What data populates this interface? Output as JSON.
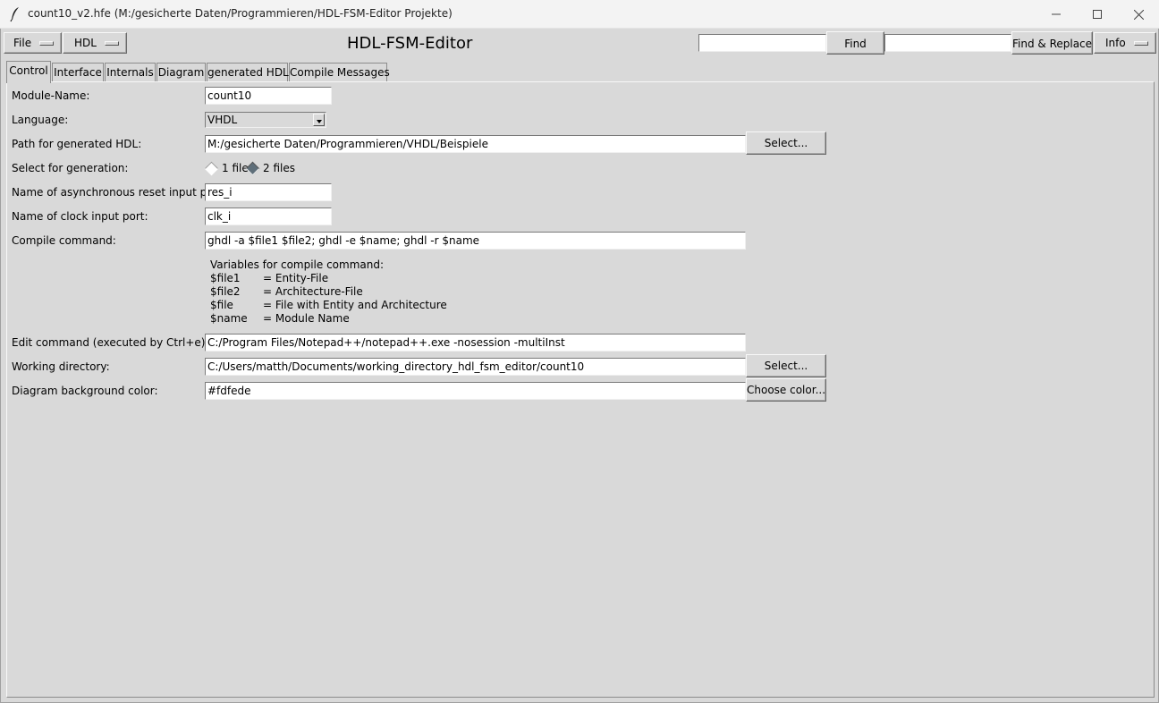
{
  "window": {
    "title": "count10_v2.hfe (M:/gesicherte Daten/Programmieren/HDL-FSM-Editor Projekte)"
  },
  "toolbar": {
    "file_menu": "File",
    "hdl_menu": "HDL",
    "app_title": "HDL-FSM-Editor",
    "find_value": "",
    "find_button": "Find",
    "replace_value": "",
    "find_replace_button": "Find & Replace",
    "info_menu": "Info"
  },
  "tabs": [
    {
      "label": "Control",
      "active": true
    },
    {
      "label": "Interface",
      "active": false
    },
    {
      "label": "Internals",
      "active": false
    },
    {
      "label": "Diagram",
      "active": false
    },
    {
      "label": "generated HDL",
      "active": false
    },
    {
      "label": "Compile Messages",
      "active": false
    }
  ],
  "control": {
    "module_name": {
      "label": "Module-Name:",
      "value": "count10"
    },
    "language": {
      "label": "Language:",
      "value": "VHDL"
    },
    "path": {
      "label": "Path for generated HDL:",
      "value": "M:/gesicherte Daten/Programmieren/VHDL/Beispiele",
      "button": "Select..."
    },
    "generation": {
      "label": "Select for generation:",
      "option1": "1 file",
      "option2": "2 files",
      "selected": "2 files"
    },
    "reset_port": {
      "label": "Name of asynchronous reset input port:",
      "value": "res_i"
    },
    "clock_port": {
      "label": "Name of clock input port:",
      "value": "clk_i"
    },
    "compile": {
      "label": "Compile command:",
      "value": "ghdl -a $file1 $file2; ghdl -e $name; ghdl -r $name"
    },
    "compile_help": {
      "heading": "Variables for compile command:",
      "vars": [
        {
          "name": "$file1",
          "desc": "= Entity-File"
        },
        {
          "name": "$file2",
          "desc": "= Architecture-File"
        },
        {
          "name": "$file",
          "desc": "= File with Entity and Architecture"
        },
        {
          "name": "$name",
          "desc": "= Module Name"
        }
      ]
    },
    "edit": {
      "label": "Edit command (executed by Ctrl+e):",
      "value": "C:/Program Files/Notepad++/notepad++.exe -nosession -multiInst"
    },
    "workdir": {
      "label": "Working directory:",
      "value": "C:/Users/matth/Documents/working_directory_hdl_fsm_editor/count10",
      "button": "Select..."
    },
    "bgcolor": {
      "label": "Diagram background color:",
      "value": "#fdfede",
      "button": "Choose color..."
    }
  },
  "icons": {
    "app": "feather-icon",
    "minimize": "minimize-icon",
    "maximize": "maximize-icon",
    "close": "close-icon"
  }
}
